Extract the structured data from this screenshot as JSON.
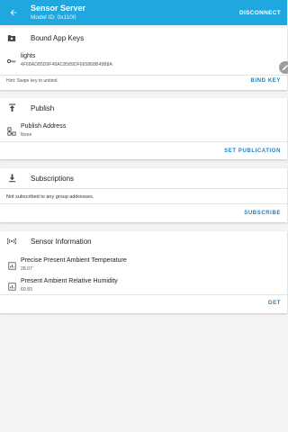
{
  "app_bar": {
    "title": "Sensor Server",
    "subtitle": "Model ID: 0x1100",
    "disconnect_label": "DISCONNECT"
  },
  "bound_app_keys": {
    "header": "Bound App Keys",
    "key_name": "lights",
    "key_value": "4F68AD85D9F48AC8589DF665868B49B8A",
    "hint": "Hint: Swipe key to unbind.",
    "bind_key_label": "BIND KEY"
  },
  "publish": {
    "header": "Publish",
    "address_label": "Publish Address",
    "address_value": "None",
    "set_publication_label": "SET PUBLICATION"
  },
  "subscriptions": {
    "header": "Subscriptions",
    "empty_text": "Not subscribed to any group addresses.",
    "subscribe_label": "SUBSCRIBE"
  },
  "sensor_information": {
    "header": "Sensor Information",
    "items": [
      {
        "label": "Precise Present Ambient Temperature",
        "value": "28.07"
      },
      {
        "label": "Present Ambient Relative Humidity",
        "value": "60.83"
      }
    ],
    "get_label": "GET"
  },
  "colors": {
    "app_bar": "#1fa8e0",
    "accent": "#1a7fc1",
    "background": "#f3f3f3"
  }
}
